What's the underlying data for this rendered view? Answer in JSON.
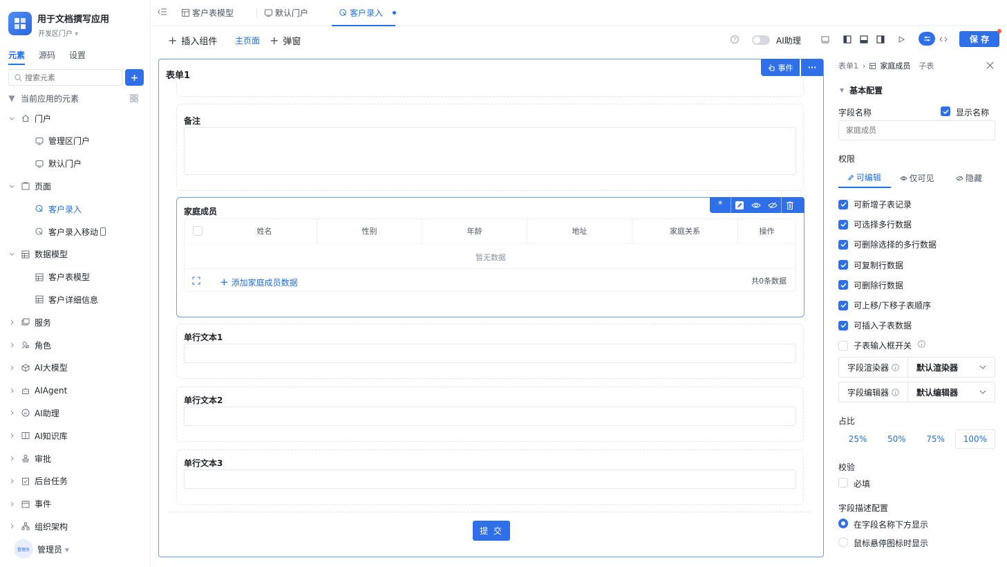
{
  "app": {
    "name": "用于文档撰写应用",
    "portal": "开发区门户"
  },
  "side_tabs": [
    "元素",
    "源码",
    "设置"
  ],
  "search": {
    "placeholder": "搜索元素"
  },
  "tree": {
    "section_title": "当前应用的元素",
    "items": [
      {
        "label": "门户",
        "level": 0,
        "icon": "home-icon",
        "expanded": true
      },
      {
        "label": "管理区门户",
        "level": 1,
        "icon": "portal-icon"
      },
      {
        "label": "默认门户",
        "level": 1,
        "icon": "portal-icon"
      },
      {
        "label": "页面",
        "level": 0,
        "icon": "page-icon",
        "expanded": true
      },
      {
        "label": "客户录入",
        "level": 1,
        "icon": "form-page-icon",
        "active": true
      },
      {
        "label": "客户录入移动",
        "level": 1,
        "icon": "form-page-icon",
        "mobile": true
      },
      {
        "label": "数据模型",
        "level": 0,
        "icon": "table-icon",
        "expanded": true
      },
      {
        "label": "客户表模型",
        "level": 1,
        "icon": "table-icon"
      },
      {
        "label": "客户详细信息",
        "level": 1,
        "icon": "table-icon"
      },
      {
        "label": "服务",
        "level": 0,
        "icon": "service-icon"
      },
      {
        "label": "角色",
        "level": 0,
        "icon": "role-icon"
      },
      {
        "label": "AI大模型",
        "level": 0,
        "icon": "cube-icon"
      },
      {
        "label": "AIAgent",
        "level": 0,
        "icon": "robot-icon"
      },
      {
        "label": "AI助理",
        "level": 0,
        "icon": "ai-icon"
      },
      {
        "label": "AI知识库",
        "level": 0,
        "icon": "book-icon"
      },
      {
        "label": "审批",
        "level": 0,
        "icon": "stamp-icon"
      },
      {
        "label": "后台任务",
        "level": 0,
        "icon": "task-icon"
      },
      {
        "label": "事件",
        "level": 0,
        "icon": "event-icon"
      },
      {
        "label": "组织架构",
        "level": 0,
        "icon": "org-icon"
      }
    ]
  },
  "user": {
    "name": "管理员",
    "avatar_text": "管理员"
  },
  "tabs": [
    {
      "label": "客户表模型",
      "icon": "table-icon"
    },
    {
      "label": "默认门户",
      "icon": "portal-icon"
    },
    {
      "label": "客户录入",
      "icon": "form-page-icon",
      "active": true
    }
  ],
  "toolbar": {
    "insert": "插入组件",
    "main_page": "主页面",
    "popup": "弹窗",
    "ai_assist": "AI助理",
    "save": "保 存"
  },
  "form": {
    "title": "表单1",
    "event_btn": "事件",
    "more_btn": "···",
    "remark_label": "备注",
    "subtable": {
      "label": "家庭成员",
      "columns": [
        "姓名",
        "性别",
        "年龄",
        "地址",
        "家庭关系",
        "操作"
      ],
      "empty_text": "暂无数据",
      "add_text": "添加家庭成员数据",
      "count_text": "共0条数据"
    },
    "text_fields": [
      "单行文本1",
      "单行文本2",
      "单行文本3"
    ],
    "submit": "提 交"
  },
  "panel": {
    "breadcrumb": [
      "表单1",
      "家庭成员",
      "子表"
    ],
    "section": "基本配置",
    "field_name_label": "字段名称",
    "show_name_label": "显示名称",
    "field_name_placeholder": "家庭成员",
    "permission_label": "权限",
    "perm_tabs": [
      "可编辑",
      "仅可见",
      "隐藏"
    ],
    "options": [
      {
        "label": "可新增子表记录",
        "checked": true
      },
      {
        "label": "可选择多行数据",
        "checked": true
      },
      {
        "label": "可删除选择的多行数据",
        "checked": true
      },
      {
        "label": "可复制行数据",
        "checked": true
      },
      {
        "label": "可删除行数据",
        "checked": true
      },
      {
        "label": "可上移/下移子表顺序",
        "checked": true
      },
      {
        "label": "可插入子表数据",
        "checked": true
      },
      {
        "label": "子表输入框开关",
        "checked": false
      }
    ],
    "renderer_label": "字段渲染器",
    "renderer_value": "默认渲染器",
    "editor_label": "字段编辑器",
    "editor_value": "默认编辑器",
    "ratio_label": "占比",
    "ratios": [
      "25%",
      "50%",
      "75%",
      "100%"
    ],
    "ratio_selected": "100%",
    "validate_label": "校验",
    "required_label": "必填",
    "desc_label": "字段描述配置",
    "desc_options": [
      "在字段名称下方显示",
      "鼠标悬停图标时显示"
    ]
  },
  "colors": {
    "accent": "#2f6fe8",
    "border_active": "#6b9cf2"
  }
}
